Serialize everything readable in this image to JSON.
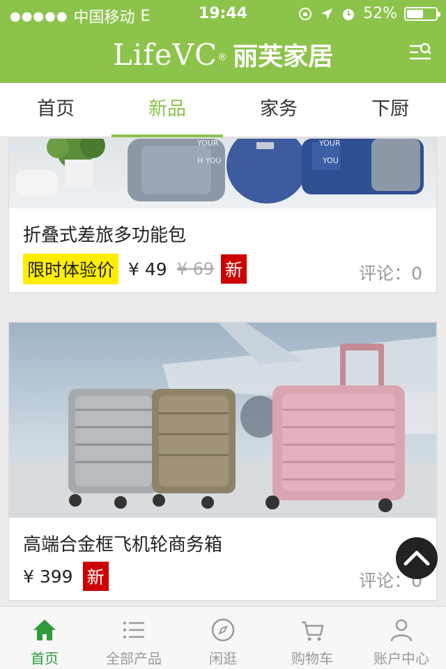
{
  "status_bar": {
    "carrier": "中国移动",
    "network": "E",
    "time": "19:44",
    "battery": "52%"
  },
  "header": {
    "brand_latin": "LifeVC",
    "brand_registered": "®",
    "brand_cn": "丽芙家居",
    "menu_icon": "search-menu-icon"
  },
  "tabs": [
    {
      "label": "首页",
      "active": false
    },
    {
      "label": "新品",
      "active": true
    },
    {
      "label": "家务",
      "active": false
    },
    {
      "label": "下厨",
      "active": false
    }
  ],
  "products": [
    {
      "title": "折叠式差旅多功能包",
      "promo": "限时体验价",
      "price": "¥ 49",
      "old_price": "¥ 69",
      "tag": "新",
      "comments": "评论：0"
    },
    {
      "title": "高端合金框飞机轮商务箱",
      "price": "¥ 399",
      "tag": "新",
      "comments": "评论：0"
    }
  ],
  "bottom_nav": [
    {
      "label": "首页",
      "icon": "home-icon",
      "active": true
    },
    {
      "label": "全部产品",
      "icon": "list-icon",
      "active": false
    },
    {
      "label": "闲逛",
      "icon": "compass-icon",
      "active": false
    },
    {
      "label": "购物车",
      "icon": "cart-icon",
      "active": false
    },
    {
      "label": "账户中心",
      "icon": "user-icon",
      "active": false
    }
  ],
  "colors": {
    "brand_green": "#8cc34a",
    "active_nav_green": "#2e9a3a",
    "promo_yellow": "#ffee00",
    "new_tag_red": "#cc0000"
  }
}
